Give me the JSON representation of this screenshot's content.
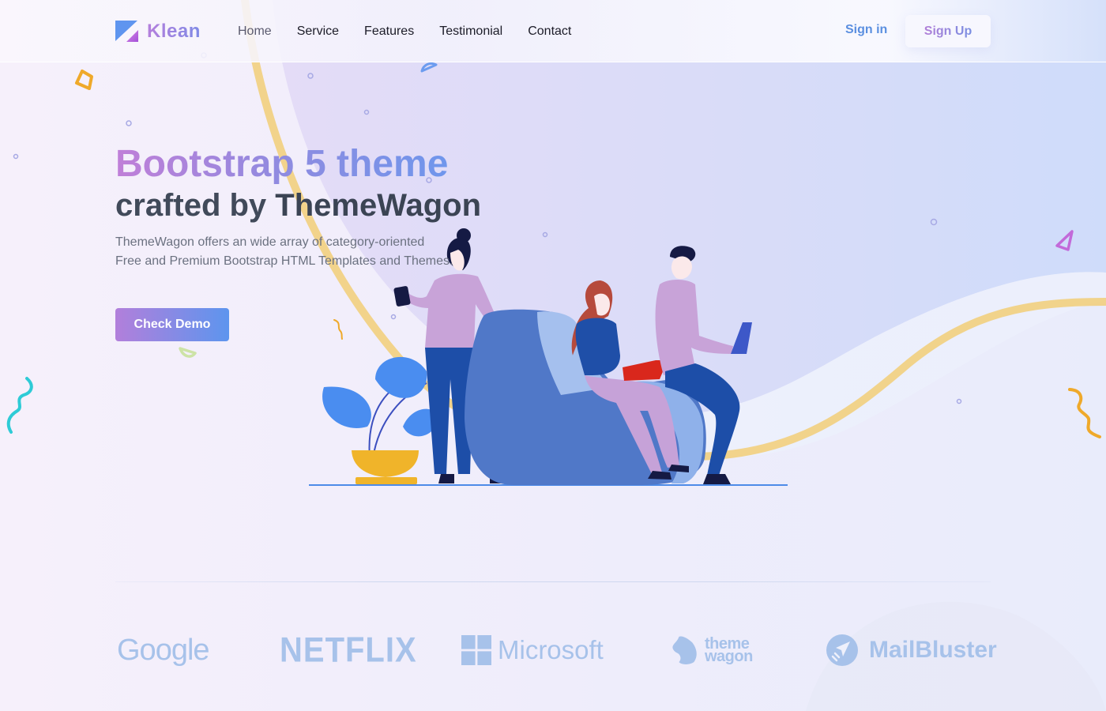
{
  "brand": {
    "name": "Klean",
    "logo_icon": "klean-logo-icon"
  },
  "nav": {
    "links": [
      {
        "label": "Home",
        "active": true
      },
      {
        "label": "Service",
        "active": false
      },
      {
        "label": "Features",
        "active": false
      },
      {
        "label": "Testimonial",
        "active": false
      },
      {
        "label": "Contact",
        "active": false
      }
    ],
    "signin_label": "Sign in",
    "signup_label": "Sign Up"
  },
  "hero": {
    "title_line1": "Bootstrap 5 theme",
    "title_line2_prefix": "crafted by ",
    "title_line2_strong": "ThemeWagon",
    "description_line1": "ThemeWagon offers an wide array of category-oriented",
    "description_line2": "Free and Premium Bootstrap HTML Templates and Themes.",
    "cta_label": "Check Demo",
    "illustration": "people-with-armchair-laptops-illustration"
  },
  "partners": [
    {
      "name": "Google",
      "icon": "google-logo"
    },
    {
      "name": "NETFLIX",
      "icon": "netflix-logo"
    },
    {
      "name": "Microsoft",
      "icon": "microsoft-logo-icon"
    },
    {
      "name_line1": "theme",
      "name_line2": "wagon",
      "icon": "themewagon-horse-icon"
    },
    {
      "name": "MailBluster",
      "icon": "mailbluster-plane-icon"
    }
  ],
  "colors": {
    "brand_gradient_start": "#c07fd8",
    "brand_gradient_end": "#6f96ec",
    "signin": "#5b8fe0",
    "partner_logo": "#a7c2ea",
    "heading_dark": "#414a5a",
    "body_text": "#6b7180",
    "wave_yellow": "#f2cf7e"
  }
}
